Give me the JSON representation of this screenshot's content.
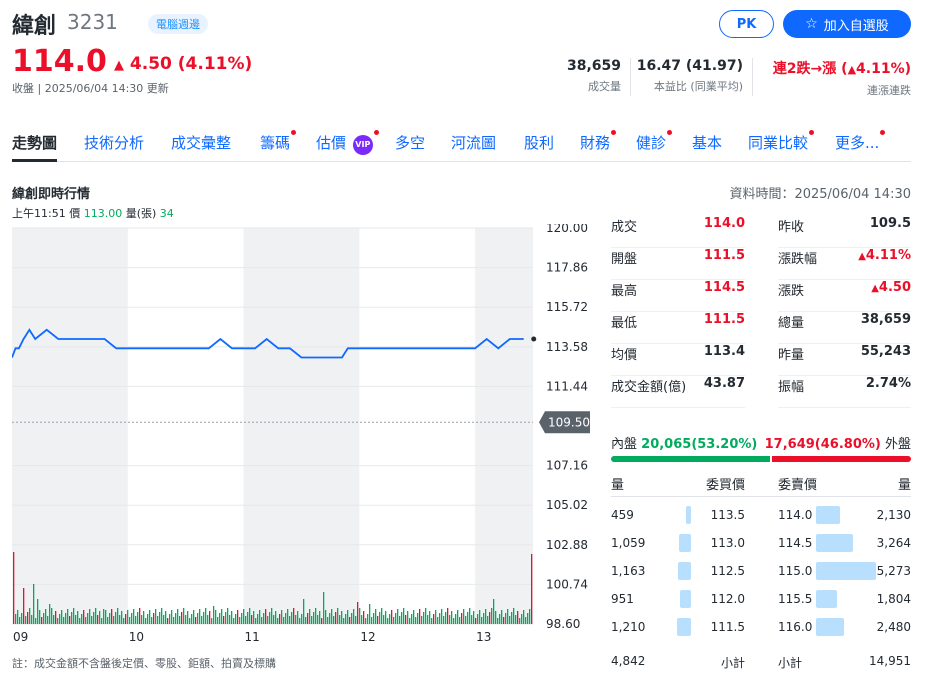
{
  "header": {
    "name": "緯創",
    "code": "3231",
    "badge": "電腦週邊",
    "pk_label": "PK",
    "watchlist_label": "加入自選股",
    "price": "114.0",
    "change": "4.50 (4.11%)",
    "close_info": "收盤 | 2025/06/04 14:30 更新"
  },
  "stats": [
    {
      "value": "38,659",
      "label": "成交量"
    },
    {
      "value": "16.47 (41.97)",
      "label": "本益比 (同業平均)"
    },
    {
      "value": "連2跌→漲 (",
      "value_tail": "4.11%)",
      "label": "連漲連跌"
    }
  ],
  "tabs": [
    {
      "label": "走勢圖",
      "active": true,
      "dot": false
    },
    {
      "label": "技術分析",
      "dot": false
    },
    {
      "label": "成交彙整",
      "dot": false
    },
    {
      "label": "籌碼",
      "dot": true
    },
    {
      "label": "估價",
      "dot": true,
      "vip": "VIP"
    },
    {
      "label": "多空",
      "dot": false
    },
    {
      "label": "河流圖",
      "dot": false
    },
    {
      "label": "股利",
      "dot": false
    },
    {
      "label": "財務",
      "dot": true
    },
    {
      "label": "健診",
      "dot": true
    },
    {
      "label": "基本",
      "dot": false
    },
    {
      "label": "同業比較",
      "dot": true
    },
    {
      "label": "更多...",
      "dot": true
    }
  ],
  "realtime": {
    "title": "緯創即時行情",
    "data_time": "資料時間：2025/06/04 14:30",
    "cursor": {
      "time": "上午11:51",
      "price_label": "價",
      "price": "113.00",
      "vol_label": "量(張)",
      "vol": "34"
    }
  },
  "chart_data": {
    "type": "line",
    "y_ticks": [
      "120.00",
      "117.86",
      "115.72",
      "113.58",
      "111.44",
      "109.50",
      "107.16",
      "105.02",
      "102.88",
      "100.74",
      "98.60"
    ],
    "x_ticks": [
      "09",
      "10",
      "11",
      "12",
      "13"
    ],
    "ylim": [
      98.6,
      120.0
    ],
    "reference_price": 109.5,
    "series": [
      {
        "x": [
          9.0,
          9.03,
          9.06,
          9.1,
          9.15,
          9.2,
          9.3,
          9.4,
          9.5,
          9.6,
          9.7,
          9.8,
          9.9,
          10.0,
          10.1,
          10.2,
          10.3,
          10.4,
          10.5,
          10.6,
          10.7,
          10.8,
          10.9,
          11.0,
          11.1,
          11.2,
          11.3,
          11.4,
          11.5,
          11.6,
          11.7,
          11.8,
          11.85,
          11.9,
          12.0,
          12.1,
          12.2,
          12.3,
          12.4,
          12.5,
          12.6,
          12.7,
          12.8,
          12.9,
          13.0,
          13.1,
          13.2,
          13.3,
          13.42
        ],
        "y": [
          113.0,
          113.5,
          113.5,
          114.0,
          114.5,
          114.0,
          114.5,
          114.0,
          114.0,
          114.0,
          114.0,
          114.0,
          113.5,
          113.5,
          113.5,
          113.5,
          113.5,
          113.5,
          113.5,
          113.5,
          113.5,
          114.0,
          113.5,
          113.5,
          113.5,
          114.0,
          113.5,
          113.5,
          113.0,
          113.0,
          113.0,
          113.0,
          113.0,
          113.5,
          113.5,
          113.5,
          113.5,
          113.5,
          113.5,
          113.5,
          113.5,
          113.5,
          113.5,
          113.5,
          113.5,
          114.0,
          113.5,
          114.0,
          114.0
        ]
      }
    ],
    "last_value_label": "109.50"
  },
  "quote": {
    "left": [
      {
        "label": "成交",
        "value": "114.0",
        "color": "red"
      },
      {
        "label": "開盤",
        "value": "111.5",
        "color": "red"
      },
      {
        "label": "最高",
        "value": "114.5",
        "color": "red"
      },
      {
        "label": "最低",
        "value": "111.5",
        "color": "red"
      },
      {
        "label": "均價",
        "value": "113.4",
        "color": "black"
      },
      {
        "label": "成交金額(億)",
        "value": "43.87",
        "color": "black"
      }
    ],
    "right": [
      {
        "label": "昨收",
        "value": "109.5",
        "color": "black"
      },
      {
        "label": "漲跌幅",
        "value": "4.11%",
        "color": "red",
        "arrow": true
      },
      {
        "label": "漲跌",
        "value": "4.50",
        "color": "red",
        "arrow": true
      },
      {
        "label": "總量",
        "value": "38,659",
        "color": "black"
      },
      {
        "label": "昨量",
        "value": "55,243",
        "color": "black"
      },
      {
        "label": "振幅",
        "value": "2.74%",
        "color": "black"
      }
    ]
  },
  "orderbook": {
    "inner_label": "內盤",
    "inner_value": "20,065(53.20%)",
    "inner_fraction": 0.532,
    "outer_value": "17,649(46.80%)",
    "outer_label": "外盤",
    "bid_header": {
      "qty": "量",
      "price": "委買價"
    },
    "ask_header": {
      "price": "委賣價",
      "qty": "量"
    },
    "bids": [
      {
        "qty": "459",
        "price": "113.5",
        "q": 459
      },
      {
        "qty": "1,059",
        "price": "113.0",
        "q": 1059
      },
      {
        "qty": "1,163",
        "price": "112.5",
        "q": 1163
      },
      {
        "qty": "951",
        "price": "112.0",
        "q": 951
      },
      {
        "qty": "1,210",
        "price": "111.5",
        "q": 1210
      }
    ],
    "asks": [
      {
        "price": "114.0",
        "qty": "2,130",
        "q": 2130
      },
      {
        "price": "114.5",
        "qty": "3,264",
        "q": 3264
      },
      {
        "price": "115.0",
        "qty": "5,273",
        "q": 5273
      },
      {
        "price": "115.5",
        "qty": "1,804",
        "q": 1804
      },
      {
        "price": "116.0",
        "qty": "2,480",
        "q": 2480
      }
    ],
    "bid_total": "4,842",
    "subtotal_label": "小計",
    "ask_total": "14,951"
  },
  "footnote": "註：成交金額不含盤後定價、零股、鉅額、拍賣及標購"
}
